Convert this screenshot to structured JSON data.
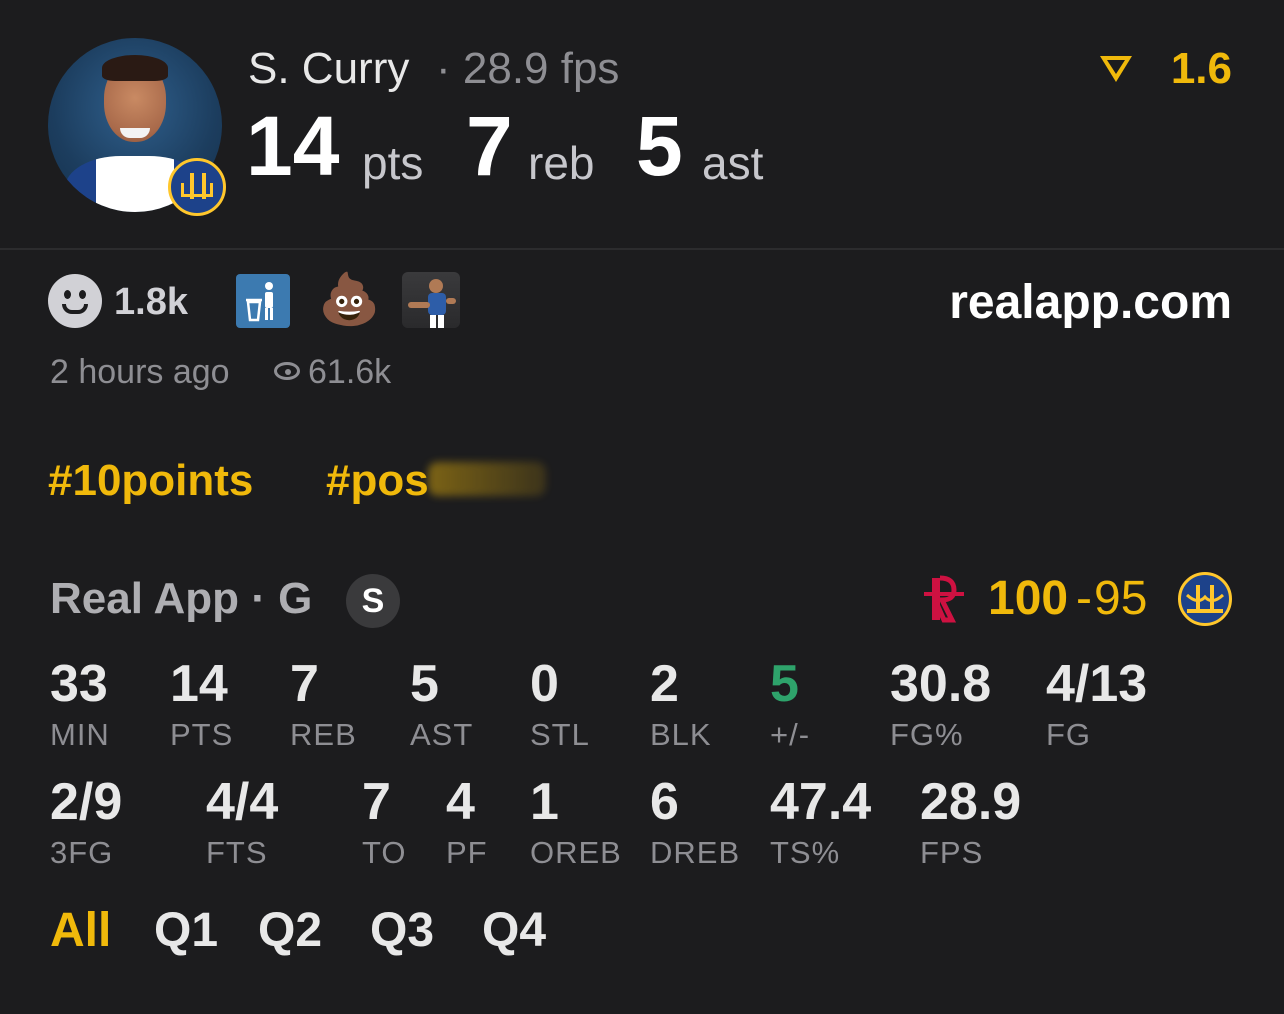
{
  "header": {
    "player_name": "S. Curry",
    "fps": "· 28.9 fps",
    "stats": [
      {
        "value": "14",
        "label": "pts"
      },
      {
        "value": "7",
        "label": "reb"
      },
      {
        "value": "5",
        "label": "ast"
      }
    ],
    "rating": "1.6",
    "avatar_icon": "player-headshot",
    "team_icon": "warriors-logo-icon"
  },
  "social": {
    "reaction_count": "1.8k",
    "reaction_icons": [
      "smiley-icon",
      "trash-icon",
      "poop-emoji-icon",
      "player-reaction-icon"
    ],
    "site": "realapp.com",
    "time": "2 hours ago",
    "views": "61.6k",
    "tags": [
      "#10points",
      "#pos"
    ]
  },
  "game": {
    "source": "Real App · G",
    "badge": "S",
    "score_home": "100",
    "score_away": "95",
    "home_team_icon": "rockets-logo-icon",
    "away_team_icon": "warriors-logo-icon"
  },
  "stats_row1": [
    {
      "value": "33",
      "label": "MIN"
    },
    {
      "value": "14",
      "label": "PTS"
    },
    {
      "value": "7",
      "label": "REB"
    },
    {
      "value": "5",
      "label": "AST"
    },
    {
      "value": "0",
      "label": "STL"
    },
    {
      "value": "2",
      "label": "BLK"
    },
    {
      "value": "5",
      "label": "+/-"
    },
    {
      "value": "30.8",
      "label": "FG%"
    },
    {
      "value": "4/13",
      "label": "FG"
    }
  ],
  "stats_row2": [
    {
      "value": "2/9",
      "label": "3FG"
    },
    {
      "value": "4/4",
      "label": "FTS"
    },
    {
      "value": "7",
      "label": "TO"
    },
    {
      "value": "4",
      "label": "PF"
    },
    {
      "value": "1",
      "label": "OREB"
    },
    {
      "value": "6",
      "label": "DREB"
    },
    {
      "value": "47.4",
      "label": "TS%"
    },
    {
      "value": "28.9",
      "label": "FPS"
    }
  ],
  "tabs": [
    "All",
    "Q1",
    "Q2",
    "Q3",
    "Q4"
  ],
  "colors": {
    "accent": "#f0b90b",
    "positive": "#2ea36b",
    "background": "#1c1c1e"
  }
}
